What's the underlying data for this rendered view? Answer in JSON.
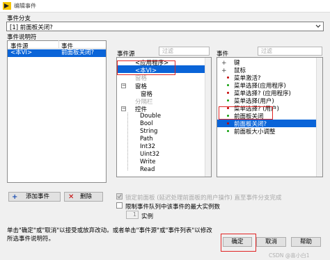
{
  "window": {
    "title": "编辑事件"
  },
  "event_branch": {
    "label": "事件分支",
    "selected": "[1] 前面板关闭?"
  },
  "event_specifiers": {
    "label": "事件说明符",
    "columns": [
      "事件源",
      "事件"
    ],
    "rows": [
      {
        "source": "<本VI>",
        "event": "前面板关闭?"
      }
    ]
  },
  "event_sources": {
    "label": "事件源",
    "filter_placeholder": "过滤",
    "items": [
      "<应用程序>",
      "<本VI>",
      "窗格",
      "窗格",
      "分隔栏",
      "控件",
      "Double",
      "Bool",
      "String",
      "Path",
      "Int32",
      "Uint32",
      "Write",
      "Read"
    ],
    "faded_item": "窗格"
  },
  "events": {
    "label": "事件",
    "filter_placeholder": "过滤",
    "items": [
      "键",
      "鼠标",
      "菜单激活?",
      "菜单选择(应用程序)",
      "菜单选择?  (应用程序)",
      "菜单选择(用户)",
      "菜单选择?  (用户)",
      "前面板关闭",
      "前面板关闭?",
      "前面板大小调整"
    ],
    "colors": {
      "accent": "#0a64d8",
      "dot_red": "#c40000",
      "dot_green": "#13a10e",
      "highlight": "#e02424"
    }
  },
  "actions": {
    "add_label": "添加事件",
    "remove_label": "删除"
  },
  "options": {
    "lock_front_panel": "锁定前面板 (延迟处理前面板的用户操作) 直至事件分支完成",
    "limit_queue": "限制事件队列中该事件的最大实例数",
    "instances_value": "1",
    "instances_label": "实例"
  },
  "help_text": "单击\"确定\"或\"取消\"以接受或放弃改动。或者单击\"事件源\"或\"事件列表\"以修改所选事件说明符。",
  "buttons": {
    "ok": "确定",
    "cancel": "取消",
    "help": "帮助"
  },
  "watermark": "CSDN @喜小白1"
}
